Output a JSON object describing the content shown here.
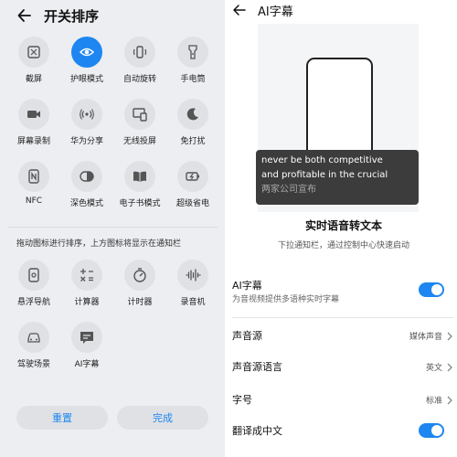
{
  "left_panel": {
    "title": "开关排序",
    "tiles_enabled": [
      {
        "label": "截屏",
        "icon": "screenshot-icon",
        "active": false
      },
      {
        "label": "护眼模式",
        "icon": "eye-icon",
        "active": true
      },
      {
        "label": "自动旋转",
        "icon": "rotate-icon",
        "active": false
      },
      {
        "label": "手电筒",
        "icon": "flashlight-icon",
        "active": false
      },
      {
        "label": "屏幕录制",
        "icon": "screen-record-icon",
        "active": false
      },
      {
        "label": "华为分享",
        "icon": "share-signal-icon",
        "active": false
      },
      {
        "label": "无线投屏",
        "icon": "wireless-projection-icon",
        "active": false
      },
      {
        "label": "免打扰",
        "icon": "moon-icon",
        "active": false
      },
      {
        "label": "NFC",
        "icon": "nfc-icon",
        "active": false
      },
      {
        "label": "深色模式",
        "icon": "dark-mode-icon",
        "active": false
      },
      {
        "label": "电子书模式",
        "icon": "book-icon",
        "active": false
      },
      {
        "label": "超级省电",
        "icon": "battery-saver-icon",
        "active": false
      }
    ],
    "hint": "拖动图标进行排序，上方图标将显示在通知栏",
    "tiles_extra": [
      {
        "label": "悬浮导航",
        "icon": "floating-nav-icon"
      },
      {
        "label": "计算器",
        "icon": "calculator-icon"
      },
      {
        "label": "计时器",
        "icon": "timer-icon"
      },
      {
        "label": "录音机",
        "icon": "recorder-icon"
      },
      {
        "label": "驾驶场景",
        "icon": "car-icon"
      },
      {
        "label": "AI字幕",
        "icon": "subtitle-icon"
      }
    ],
    "reset_label": "重置",
    "done_label": "完成"
  },
  "right_panel": {
    "title": "AI字幕",
    "caption_en_line1": "never be both competitive",
    "caption_en_line2": "and profitable in the crucial",
    "caption_cn": "两家公司宣布",
    "feature_title": "实时语音转文本",
    "feature_sub": "下拉通知栏，通过控制中心快速启动",
    "settings": {
      "ai_subtitle": {
        "label": "AI字幕",
        "sub": "为音视频提供多语种实时字幕",
        "on": true
      },
      "source": {
        "label": "声音源",
        "value": "媒体声音"
      },
      "source_lang": {
        "label": "声音源语言",
        "value": "英文"
      },
      "font_size": {
        "label": "字号",
        "value": "标准"
      },
      "translate": {
        "label": "翻译成中文",
        "on": true
      }
    }
  },
  "colors": {
    "accent": "#1d86f0",
    "tile_bg": "#dfe1e5",
    "panel_bg": "#eceef1"
  }
}
